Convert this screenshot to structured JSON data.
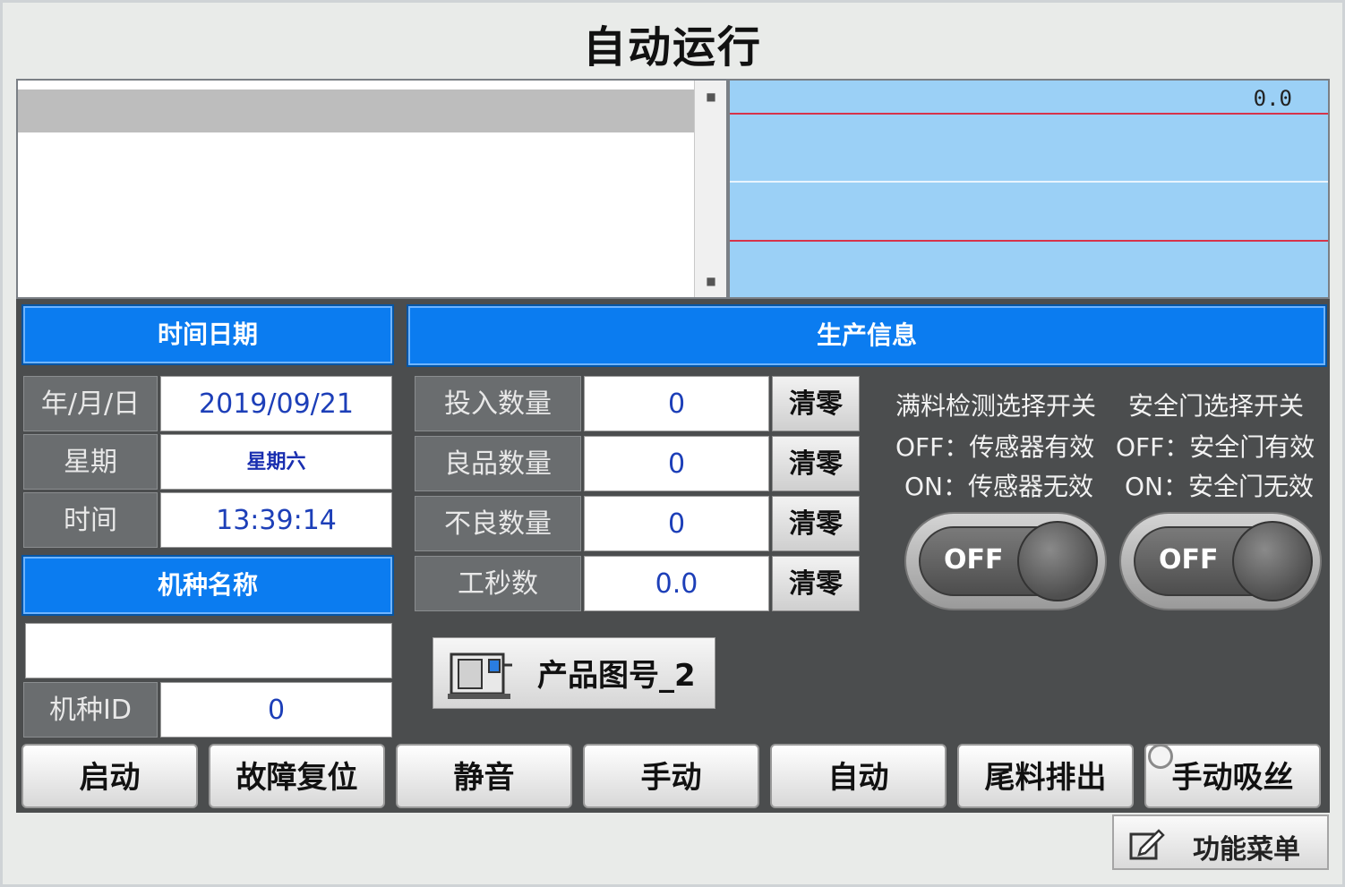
{
  "title": "自动运行",
  "trend": {
    "readout": "0.0"
  },
  "datetime": {
    "header": "时间日期",
    "rows": [
      {
        "label": "年/月/日",
        "value": "2019/09/21"
      },
      {
        "label": "星期",
        "value": "星期六"
      },
      {
        "label": "时间",
        "value": "13:39:14"
      }
    ]
  },
  "model": {
    "header": "机种名称",
    "name_value": "",
    "id_label": "机种ID",
    "id_value": "0"
  },
  "production": {
    "header": "生产信息",
    "rows": [
      {
        "label": "投入数量",
        "value": "0",
        "clear": "清零"
      },
      {
        "label": "良品数量",
        "value": "0",
        "clear": "清零"
      },
      {
        "label": "不良数量",
        "value": "0",
        "clear": "清零"
      },
      {
        "label": "工秒数",
        "value": "0.0",
        "clear": "清零"
      }
    ],
    "product_button": "产品图号_2"
  },
  "switches": [
    {
      "title": "满料检测选择开关",
      "off_desc": "OFF：传感器有效",
      "on_desc": "ON：传感器无效",
      "state": "OFF"
    },
    {
      "title": "安全门选择开关",
      "off_desc": "OFF：安全门有效",
      "on_desc": "ON：安全门无效",
      "state": "OFF"
    }
  ],
  "buttons": [
    "启动",
    "故障复位",
    "静音",
    "手动",
    "自动",
    "尾料排出",
    "手动吸丝"
  ],
  "menu_button": "功能菜单",
  "colors": {
    "header_blue": "#0b7cf0",
    "panel_dark": "#4b4d4e",
    "trend_bg": "#9bd0f6",
    "limit_red": "#d6334a"
  }
}
